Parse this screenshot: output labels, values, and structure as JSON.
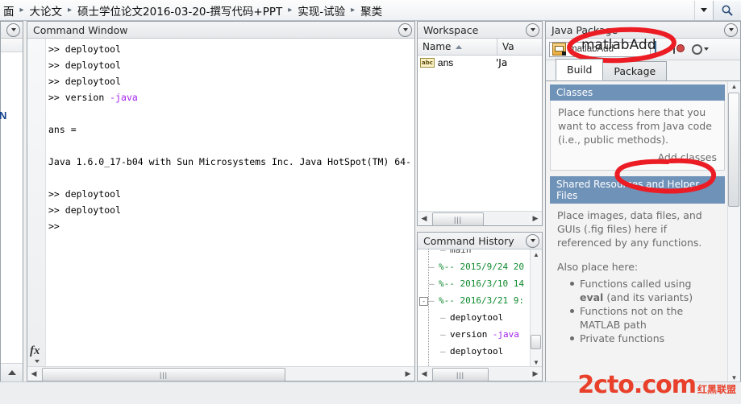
{
  "breadcrumb": {
    "items": [
      "面",
      "大论文",
      "硕士学位论文2016-03-20-撰写代码+PPT",
      "实现-试验",
      "聚类"
    ],
    "separator": "▸",
    "dropdown_icon": "chevron-down-icon",
    "search_icon": "search-icon"
  },
  "left_stub": {
    "dropdown_icon": "panel-menu-icon",
    "mark": "N",
    "collapse_icon": "chevron-up-icon"
  },
  "command_window": {
    "title": "Command Window",
    "dropdown_icon": "panel-menu-icon",
    "prompt_glyph": "fx",
    "lines": [
      {
        "prompt": ">> ",
        "cmd": "deploytool",
        "opt": ""
      },
      {
        "prompt": ">> ",
        "cmd": "deploytool",
        "opt": ""
      },
      {
        "prompt": ">> ",
        "cmd": "deploytool",
        "opt": ""
      },
      {
        "prompt": ">> ",
        "cmd": "version ",
        "opt": "-java"
      },
      {
        "prompt": "",
        "cmd": "",
        "opt": ""
      },
      {
        "prompt": "",
        "cmd": "ans =",
        "opt": ""
      },
      {
        "prompt": "",
        "cmd": "",
        "opt": ""
      },
      {
        "prompt": "",
        "cmd": "Java 1.6.0_17-b04 with Sun Microsystems Inc. Java HotSpot(TM) 64-",
        "opt": ""
      },
      {
        "prompt": "",
        "cmd": "",
        "opt": ""
      },
      {
        "prompt": ">> ",
        "cmd": "deploytool",
        "opt": ""
      },
      {
        "prompt": ">> ",
        "cmd": "deploytool",
        "opt": ""
      },
      {
        "prompt": ">> ",
        "cmd": "",
        "opt": ""
      }
    ],
    "scroll_left_icon": "triangle-left-icon",
    "scroll_right_icon": "triangle-right-icon",
    "scroll_grip": "|||"
  },
  "workspace": {
    "title": "Workspace",
    "dropdown_icon": "panel-menu-icon",
    "columns": [
      "Name",
      "Va"
    ],
    "sort_icon": "sort-ascending-icon",
    "rows": [
      {
        "icon": "abc",
        "name": "ans",
        "value": "'Ja"
      }
    ],
    "scroll_left_icon": "triangle-left-icon",
    "scroll_right_icon": "triangle-right-icon",
    "scroll_grip": "|||"
  },
  "command_history": {
    "title": "Command History",
    "dropdown_icon": "panel-menu-icon",
    "entries": [
      {
        "kind": "cut",
        "text": "main",
        "indent": 2,
        "expander": ""
      },
      {
        "kind": "green",
        "text": "%-- 2015/9/24 20",
        "indent": 1,
        "expander": ""
      },
      {
        "kind": "green",
        "text": "%-- 2016/3/10 14",
        "indent": 1,
        "expander": ""
      },
      {
        "kind": "green",
        "text": "%-- 2016/3/21 9:",
        "indent": 1,
        "expander": "minus"
      },
      {
        "kind": "black",
        "text": "deploytool",
        "indent": 2,
        "expander": ""
      },
      {
        "kind": "mixed",
        "text": "version ",
        "opt": "-java",
        "indent": 2,
        "expander": ""
      },
      {
        "kind": "black",
        "text": "deploytool",
        "indent": 2,
        "expander": ""
      }
    ],
    "scroll_up_icon": "triangle-up-icon",
    "scroll_down_icon": "triangle-down-icon",
    "scroll_left_icon": "triangle-left-icon",
    "scroll_right_icon": "triangle-right-icon",
    "scroll_grip": "|||"
  },
  "java_package": {
    "title": "Java Package",
    "dropdown_icon": "panel-menu-icon",
    "toolbar": {
      "project_combo_value": "matlabAdd",
      "project_icon": "project-folder-icon",
      "build_icon": "build-icon",
      "package_icon": "package-icon",
      "settings_icon": "gear-icon",
      "settings_caret_icon": "chevron-down-icon"
    },
    "tabs": [
      {
        "label": "Build",
        "active": true
      },
      {
        "label": "Package",
        "active": false
      }
    ],
    "sections": [
      {
        "header": "Classes",
        "text": "Place functions here that you want to access from Java code (i.e., public methods).",
        "link": "Add classes"
      },
      {
        "header": "Shared Resources and Helper Files",
        "text": "Place images, data files, and GUIs (.fig files) here if referenced by any functions.",
        "subtitle": "Also place here:",
        "bullets": [
          {
            "pre": "Functions called using ",
            "bold": "eval",
            "post": " (and its variants)"
          },
          {
            "pre": "Functions not on the MATLAB path",
            "bold": "",
            "post": ""
          },
          {
            "pre": "Private functions",
            "bold": "",
            "post": ""
          }
        ]
      }
    ],
    "scroll_up_icon": "triangle-up-icon",
    "scroll_down_icon": "triangle-down-icon",
    "scroll_grip": "≡"
  },
  "annotations": {
    "color": "#ec1c24",
    "items": [
      {
        "name": "matlabAdd-circle",
        "label": "matlabAdd"
      },
      {
        "name": "add-classes-circle",
        "label": ""
      }
    ]
  },
  "watermark": {
    "main": "2cto.com",
    "sub": "红黑联盟",
    "color": "#e8402a"
  }
}
